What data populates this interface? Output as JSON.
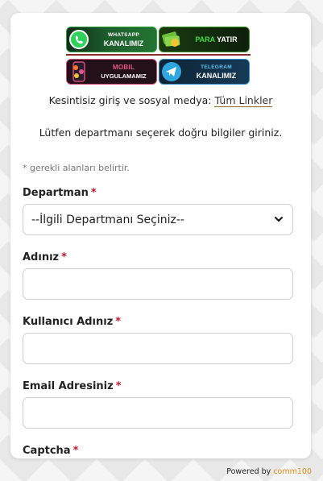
{
  "banners": {
    "whatsapp": {
      "line1": "WHATSAPP",
      "line2": "KANALIMIZ"
    },
    "para": {
      "line1": "PARA",
      "line2": "YATIR"
    },
    "mobil": {
      "line1": "MOBIL",
      "line2": "UYGULAMAMIZ"
    },
    "telegram": {
      "line1": "TELEGRAM",
      "line2": "KANALIMIZ"
    }
  },
  "links_line": {
    "text": "Kesintisiz giriş ve sosyal medya:",
    "link": "Tüm Linkler"
  },
  "intro": "Lütfen departmanı seçerek doğru bilgiler giriniz.",
  "required_note": "* gerekli alanları belirtir.",
  "fields": {
    "departman": {
      "label": "Departman",
      "star": "*",
      "value": "--İlgili Departmanı Seçiniz--"
    },
    "adiniz": {
      "label": "Adınız",
      "star": "*",
      "value": ""
    },
    "kullanici": {
      "label": "Kullanıcı Adınız",
      "star": "*",
      "value": ""
    },
    "email": {
      "label": "Email Adresiniz",
      "star": "*",
      "value": ""
    },
    "captcha": {
      "label": "Captcha",
      "star": "*"
    }
  },
  "powered": {
    "prefix": "Powered by",
    "brand": "comm100"
  },
  "colors": {
    "required_star": "#c0192b",
    "link_underline": "#8d6c2a",
    "brand": "#e48c1a"
  }
}
